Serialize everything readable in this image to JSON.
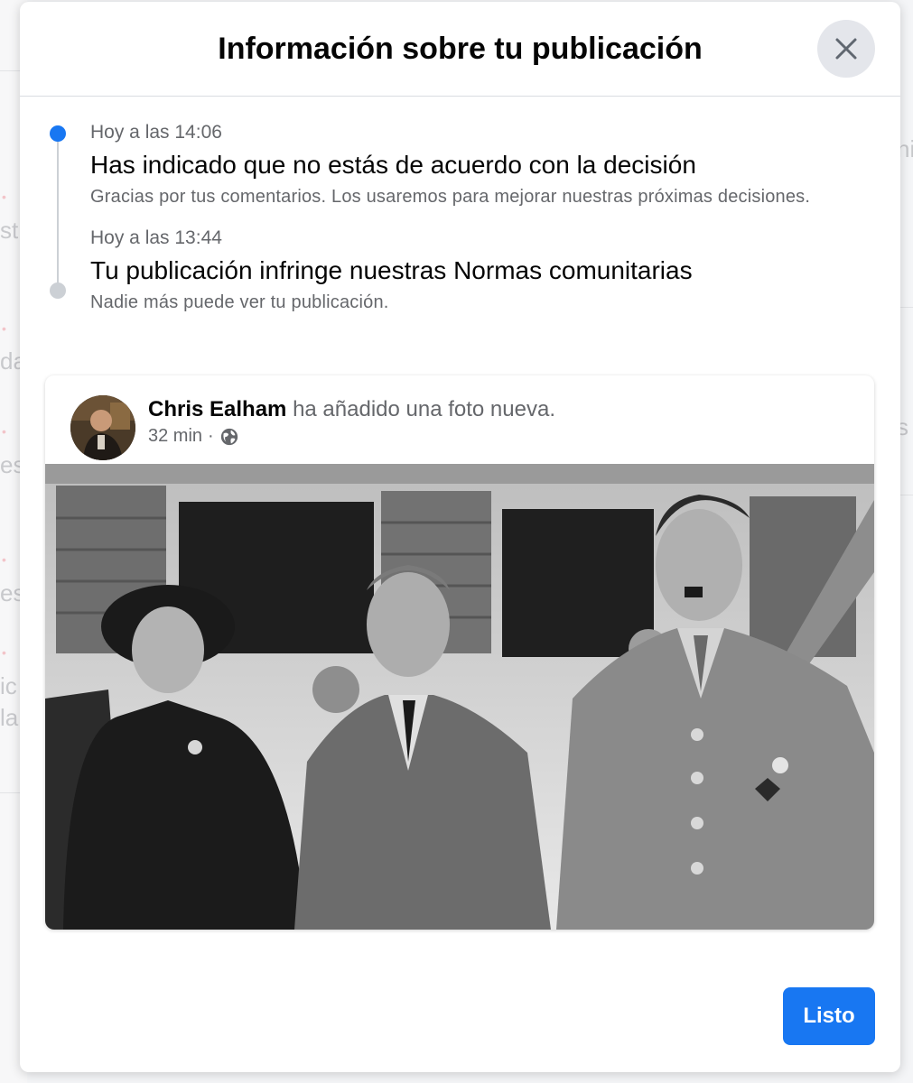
{
  "modal": {
    "title": "Información sobre tu publicación",
    "close_icon": "close-icon",
    "done_label": "Listo"
  },
  "timeline": [
    {
      "time": "Hoy a las 14:06",
      "heading": "Has indicado que no estás de acuerdo con la decisión",
      "description": "Gracias por tus comentarios. Los usaremos para mejorar nuestras próximas decisiones.",
      "status": "active"
    },
    {
      "time": "Hoy a las 13:44",
      "heading": "Tu publicación infringe nuestras Normas comunitarias",
      "description": "Nadie más puede ver tu publicación.",
      "status": "inactive"
    }
  ],
  "post": {
    "author": "Chris Ealham",
    "action": "ha añadido una foto nueva.",
    "time": "32 min",
    "separator": "·",
    "audience_icon": "globe-icon",
    "photo": "black-and-white historical photo of three people in front of a building"
  },
  "colors": {
    "accent": "#1877f2",
    "text_secondary": "#65676b",
    "timeline_inactive": "#ccd0d5"
  }
}
